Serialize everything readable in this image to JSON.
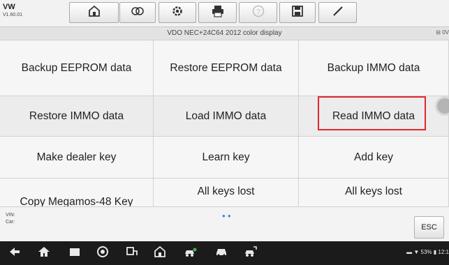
{
  "header": {
    "brand": "VW",
    "version": "V1.60.01",
    "toolbar": [
      {
        "name": "home-icon"
      },
      {
        "name": "vehicle-swap-icon"
      },
      {
        "name": "settings-gear-icon"
      },
      {
        "name": "print-icon"
      },
      {
        "name": "help-icon"
      },
      {
        "name": "save-icon"
      },
      {
        "name": "edit-pen-icon"
      }
    ]
  },
  "subheader": {
    "title": "VDO NEC+24C64 2012 color display",
    "battery": "0V"
  },
  "functions": [
    [
      "Backup EEPROM data",
      "Restore EEPROM data",
      "Backup IMMO data"
    ],
    [
      "Restore IMMO data",
      "Load IMMO data",
      "Read IMMO data"
    ],
    [
      "Make dealer key",
      "Learn key",
      "Add key"
    ],
    [
      "Copy Megamos-48 Key",
      "All keys lost",
      "All keys lost"
    ]
  ],
  "highlighted": "Read IMMO data",
  "info": {
    "vin_label": "VIN:",
    "car_label": "Car:",
    "esc_label": "ESC"
  },
  "statusbar": {
    "battery": "53%",
    "time": "12:1"
  },
  "colors": {
    "highlight": "#e2272b",
    "accent": "#3a7fd6"
  }
}
